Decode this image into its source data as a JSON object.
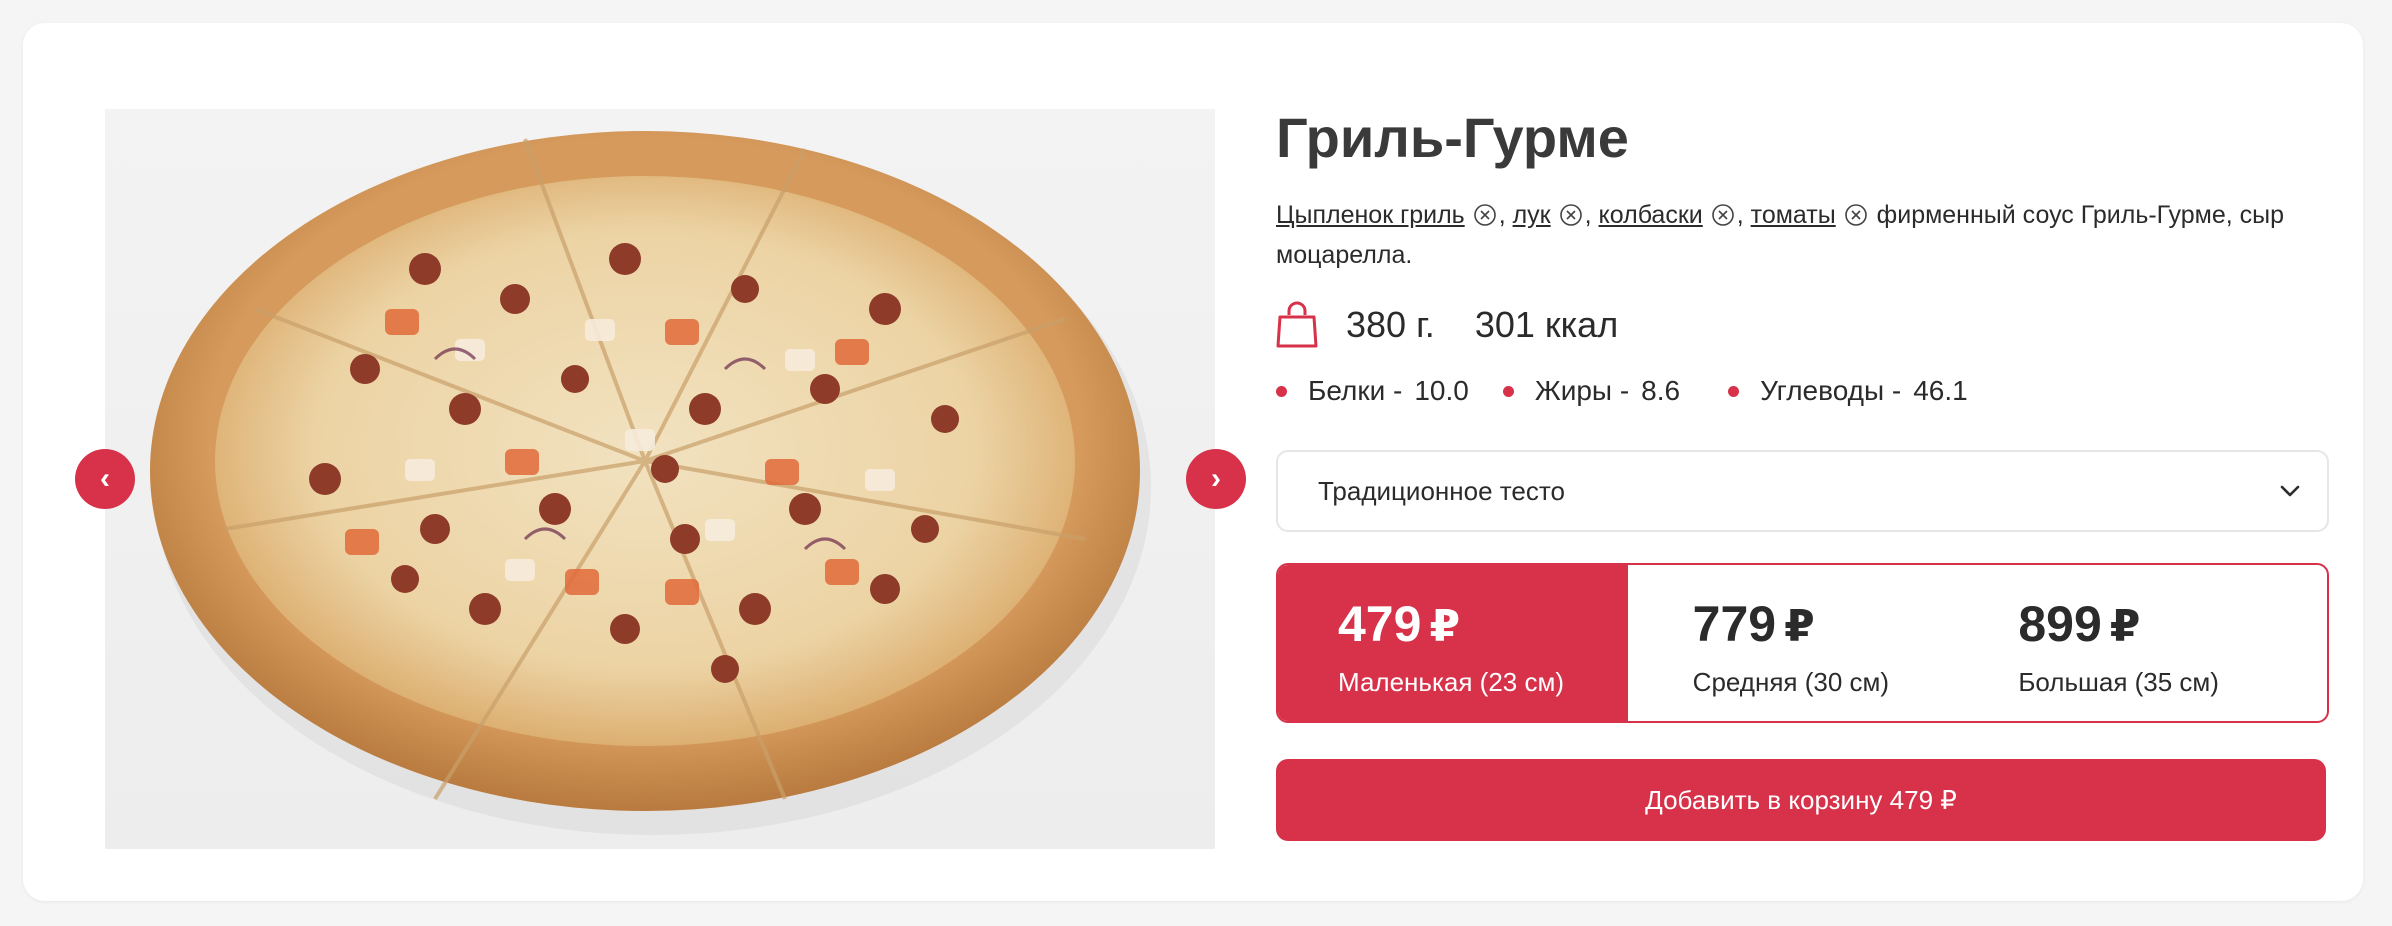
{
  "product": {
    "title": "Гриль-Гурме",
    "ingredients": [
      {
        "name": "Цыпленок гриль",
        "sep": ","
      },
      {
        "name": "лук",
        "sep": ","
      },
      {
        "name": "колбаски",
        "sep": ","
      },
      {
        "name": "томаты",
        "sep": ""
      }
    ],
    "ingredients_rest": "фирменный соус Гриль-Гурме, сыр моцарелла.",
    "weight": "380 г.",
    "calories": "301 ккал",
    "nutrition": [
      {
        "label": "Белки -",
        "value": "10.0"
      },
      {
        "label": "Жиры -",
        "value": "8.6"
      },
      {
        "label": "Углеводы -",
        "value": "46.1"
      }
    ]
  },
  "gallery": {
    "prev_label": "‹",
    "next_label": "›"
  },
  "dough": {
    "selected": "Традиционное тесто"
  },
  "sizes": [
    {
      "price": "479",
      "currency": "₽",
      "label": "Маленькая (23 см)",
      "active": true
    },
    {
      "price": "779",
      "currency": "₽",
      "label": "Средняя (30 см)",
      "active": false
    },
    {
      "price": "899",
      "currency": "₽",
      "label": "Большая (35 см)",
      "active": false
    }
  ],
  "cart_button": {
    "label": "Добавить в корзину 479 ₽"
  },
  "colors": {
    "accent": "#d7324a",
    "background": "#f5f5f5",
    "card": "#ffffff"
  }
}
